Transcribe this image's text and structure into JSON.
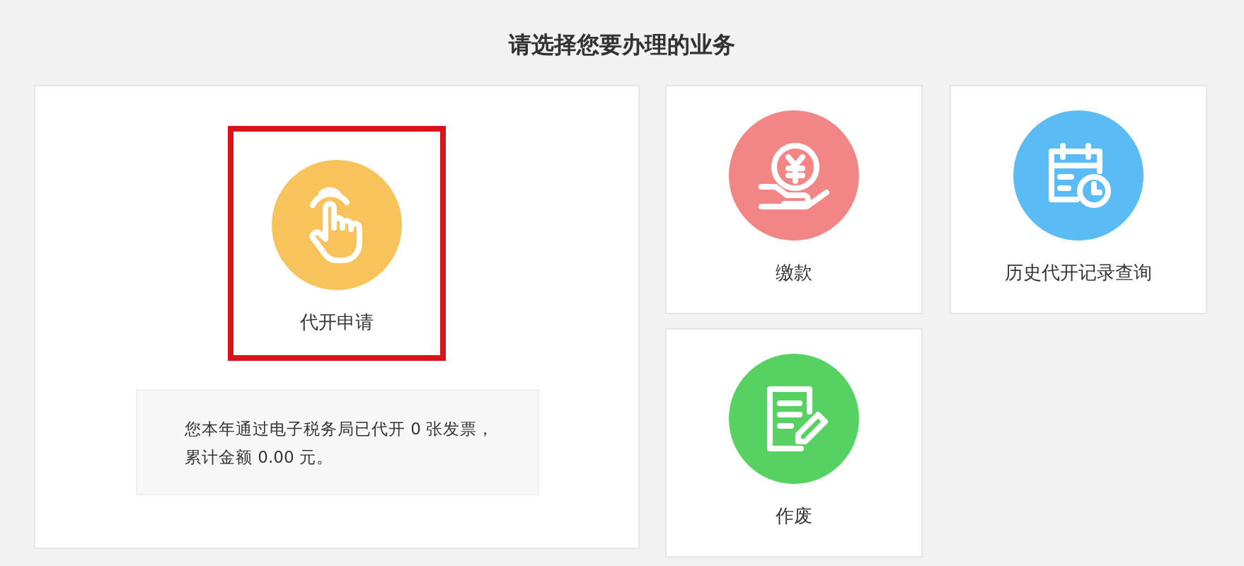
{
  "heading": "请选择您要办理的业务",
  "services": [
    {
      "kind": "hand",
      "label": "代开申请",
      "color": "#f9c35c",
      "highlighted": true,
      "note": "您本年通过电子税务局已代开 0 张发票，累计金额 0.00 元。"
    },
    {
      "kind": "payment",
      "label": "缴款",
      "color": "#f28585",
      "highlighted": false
    },
    {
      "kind": "calendar",
      "label": "历史代开记录查询",
      "color": "#5bbcf5",
      "highlighted": false
    },
    {
      "kind": "edit",
      "label": "作废",
      "color": "#58d163",
      "highlighted": false
    }
  ]
}
